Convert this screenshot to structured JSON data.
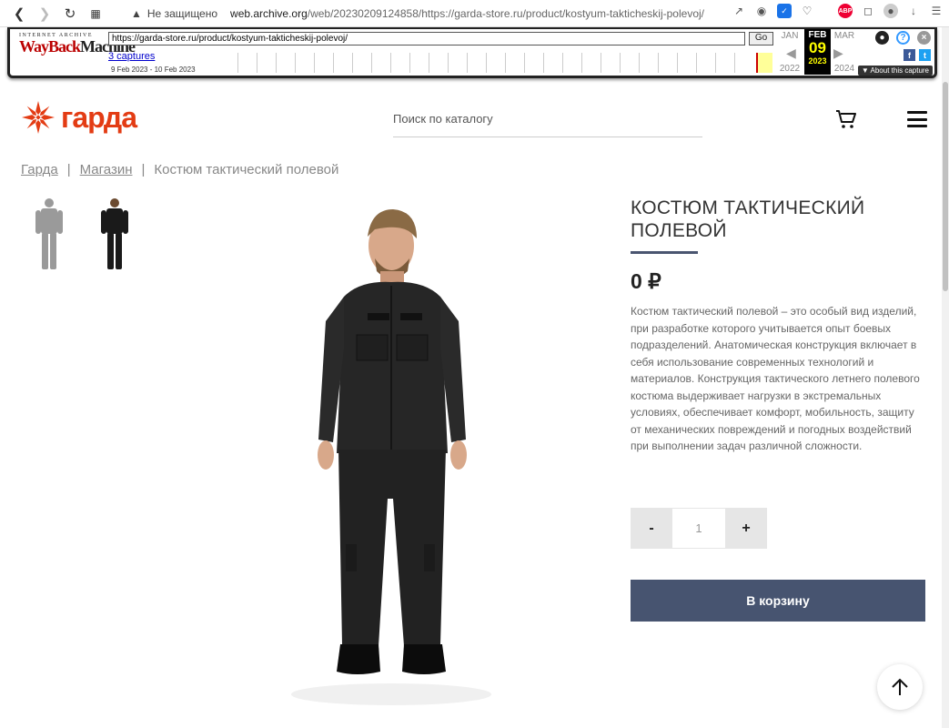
{
  "browser": {
    "security_label": "Не защищено",
    "url_domain": "web.archive.org",
    "url_path": "/web/20230209124858/https://garda-store.ru/product/kostyum-takticheskij-polevoj/"
  },
  "wayback": {
    "logo_top": "INTERNET ARCHIVE",
    "logo_main_a": "WayBack",
    "logo_main_b": "Machine",
    "url_value": "https://garda-store.ru/product/kostyum-takticheskij-polevoj/",
    "go_label": "Go",
    "captures": "3 captures",
    "range": "9 Feb 2023 - 10 Feb 2023",
    "prev_month": "JAN",
    "cur_month": "FEB",
    "cur_day": "09",
    "next_month": "MAR",
    "prev_year": "2022",
    "cur_year": "2023",
    "next_year": "2024",
    "about": "About this capture"
  },
  "site": {
    "logo_text": "гарда",
    "search_placeholder": "Поиск по каталогу",
    "brand_color": "#e33c14"
  },
  "breadcrumb": {
    "home": "Гарда",
    "shop": "Магазин",
    "current": "Костюм тактический полевой",
    "sep": "|"
  },
  "product": {
    "title": "КОСТЮМ ТАКТИЧЕСКИЙ ПОЛЕВОЙ",
    "price": "0 ₽",
    "description": "Костюм тактический полевой – это особый вид изделий, при разработке которого учитывается опыт боевых подразделений. Анатомическая конструкция включает в себя использование современных технологий и материалов. Конструкция тактического летнего полевого костюма выдерживает нагрузки в экстремальных условиях, обеспечивает комфорт, мобильность, защиту от механических повреждений и погодных воздействий при выполнении задач различной сложности.",
    "qty_minus": "-",
    "qty_value": "1",
    "qty_plus": "+",
    "add_to_cart": "В корзину",
    "accent_color": "#475470"
  }
}
